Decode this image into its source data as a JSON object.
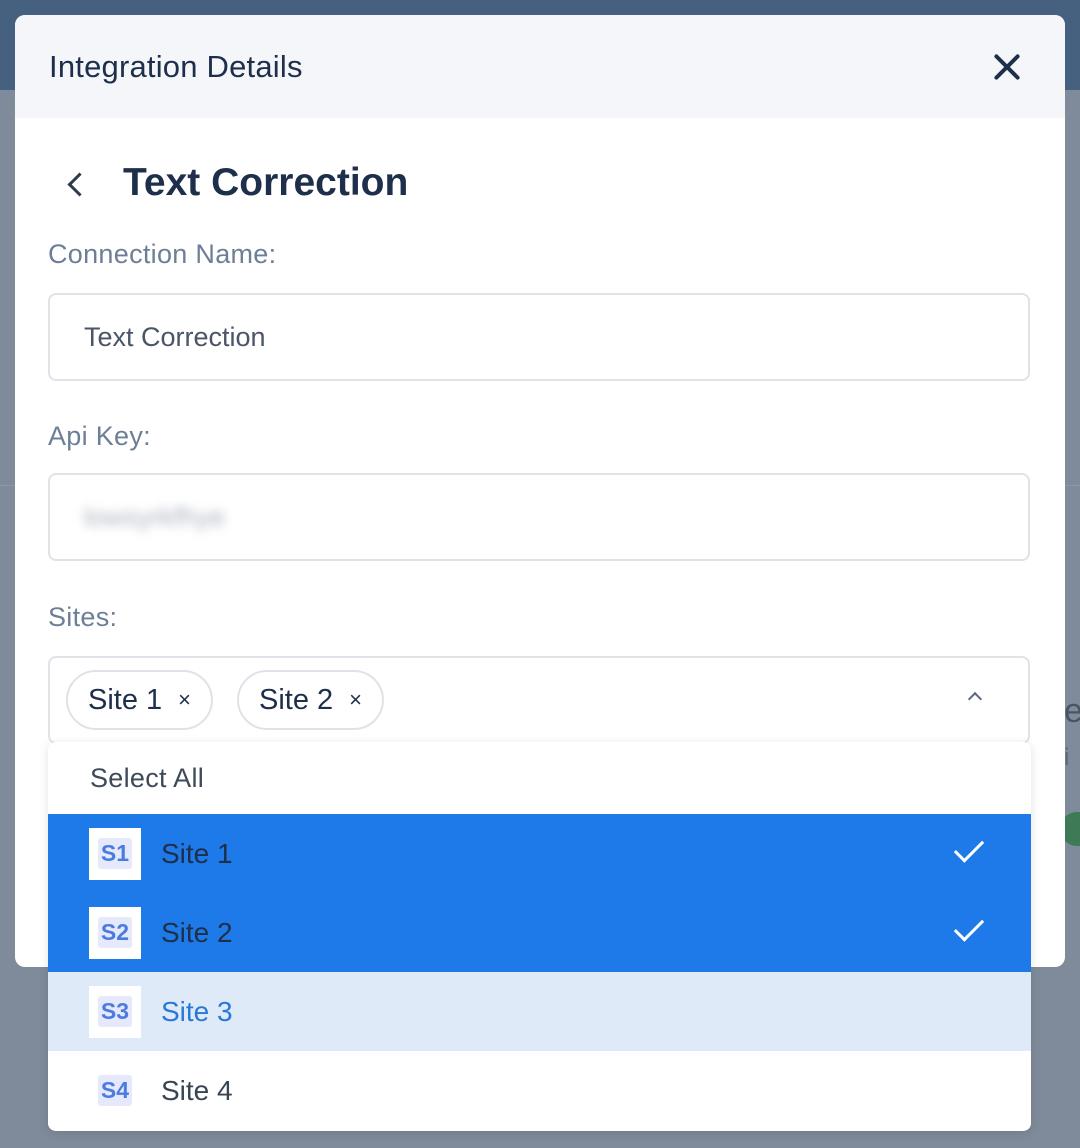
{
  "modal": {
    "title": "Integration Details",
    "subtitle": "Text Correction"
  },
  "form": {
    "connection_name_label": "Connection Name:",
    "connection_name_value": "Text Correction",
    "api_key_label": "Api Key:",
    "api_key_value": "lowsyrkfhye",
    "sites_label": "Sites:"
  },
  "sites_select": {
    "chips": [
      {
        "label": "Site 1",
        "remove": "×"
      },
      {
        "label": "Site 2",
        "remove": "×"
      }
    ],
    "select_all_label": "Select All",
    "options": [
      {
        "badge": "S1",
        "label": "Site 1",
        "state": "selected"
      },
      {
        "badge": "S2",
        "label": "Site 2",
        "state": "selected"
      },
      {
        "badge": "S3",
        "label": "Site 3",
        "state": "hovered"
      },
      {
        "badge": "S4",
        "label": "Site 4",
        "state": "none"
      }
    ]
  },
  "colors": {
    "selected_bg": "#1e7ae8",
    "hover_bg": "#dfeaf8",
    "title_text": "#1d2f4a"
  }
}
